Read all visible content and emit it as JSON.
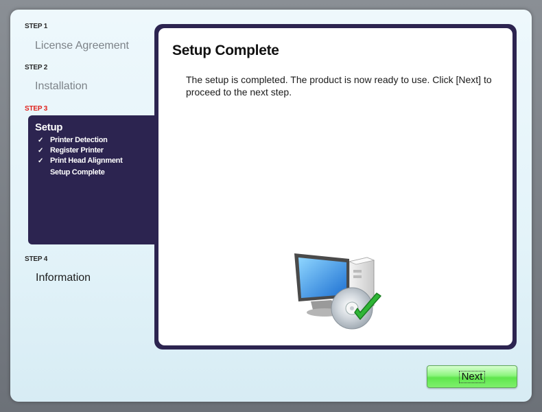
{
  "steps": [
    {
      "label": "STEP 1",
      "title": "License Agreement"
    },
    {
      "label": "STEP 2",
      "title": "Installation"
    },
    {
      "label": "STEP 3",
      "title": "Setup"
    },
    {
      "label": "STEP 4",
      "title": "Information"
    }
  ],
  "setup_substeps": [
    {
      "check": "✓",
      "label": "Printer Detection"
    },
    {
      "check": "✓",
      "label": "Register Printer"
    },
    {
      "check": "✓",
      "label": "Print Head Alignment"
    },
    {
      "check": "",
      "label": "Setup Complete"
    }
  ],
  "content": {
    "title": "Setup Complete",
    "text": "The setup is completed. The product is now ready to use. Click [Next] to proceed to the next step."
  },
  "next_button": {
    "label": "Next"
  },
  "colors": {
    "active_step_label": "#e0201b",
    "panel": "#2c2450",
    "button": "#6fe85f"
  },
  "icons": {
    "illustration": "computer-disc-checkmark-icon"
  }
}
